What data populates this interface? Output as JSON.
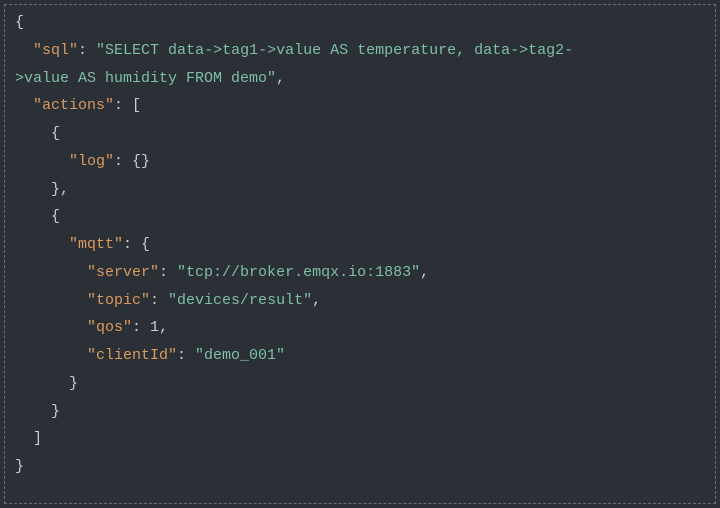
{
  "code": {
    "keys": {
      "sql": "\"sql\"",
      "actions": "\"actions\"",
      "log": "\"log\"",
      "mqtt": "\"mqtt\"",
      "server": "\"server\"",
      "topic": "\"topic\"",
      "qos": "\"qos\"",
      "clientId": "\"clientId\""
    },
    "values": {
      "sql_part1": "\"SELECT data->tag1->value AS temperature, data->tag2-",
      "sql_part2": ">value AS humidity FROM demo\"",
      "server": "\"tcp://broker.emqx.io:1883\"",
      "topic": "\"devices/result\"",
      "qos": "1",
      "clientId": "\"demo_001\""
    },
    "punct": {
      "open_brace": "{",
      "close_brace": "}",
      "open_bracket": "[",
      "close_bracket": "]",
      "colon_sp": ": ",
      "comma": ",",
      "empty_obj": "{}"
    },
    "indents": {
      "s2": "  ",
      "s4": "    ",
      "s6": "      ",
      "s8": "        "
    }
  }
}
